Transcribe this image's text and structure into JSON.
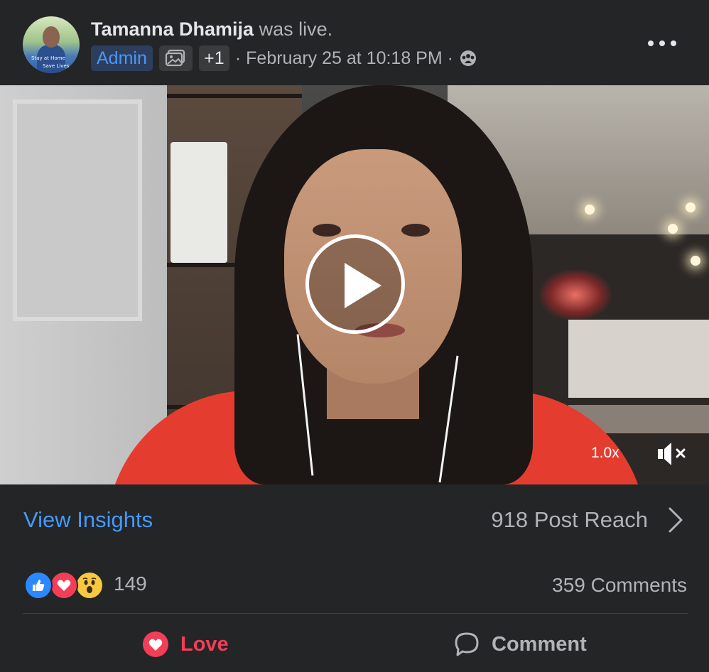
{
  "post": {
    "author": "Tamanna Dhamija",
    "action": "was live.",
    "avatar_text_1": "Stay at Home",
    "avatar_text_2": "Save Lives",
    "admin_label": "Admin",
    "extra_count": "+1",
    "timestamp": "· February 25 at 10:18 PM ·",
    "audience_icon": "community-icon",
    "more_icon": "more-dots-icon"
  },
  "video": {
    "play_icon": "play-icon",
    "speed_label": "1.0x",
    "mute_icon": "muted-speaker-icon"
  },
  "insights": {
    "link_label": "View Insights",
    "reach_label": "918 Post Reach"
  },
  "reactions": {
    "icons": [
      "like-icon",
      "love-icon",
      "wow-icon"
    ],
    "count": "149",
    "comments_label": "359 Comments"
  },
  "actions": {
    "love_label": "Love",
    "comment_label": "Comment"
  },
  "colors": {
    "background": "#242526",
    "link_blue": "#4599ff",
    "love_red": "#f33e58",
    "muted_text": "#b0b3b8"
  }
}
